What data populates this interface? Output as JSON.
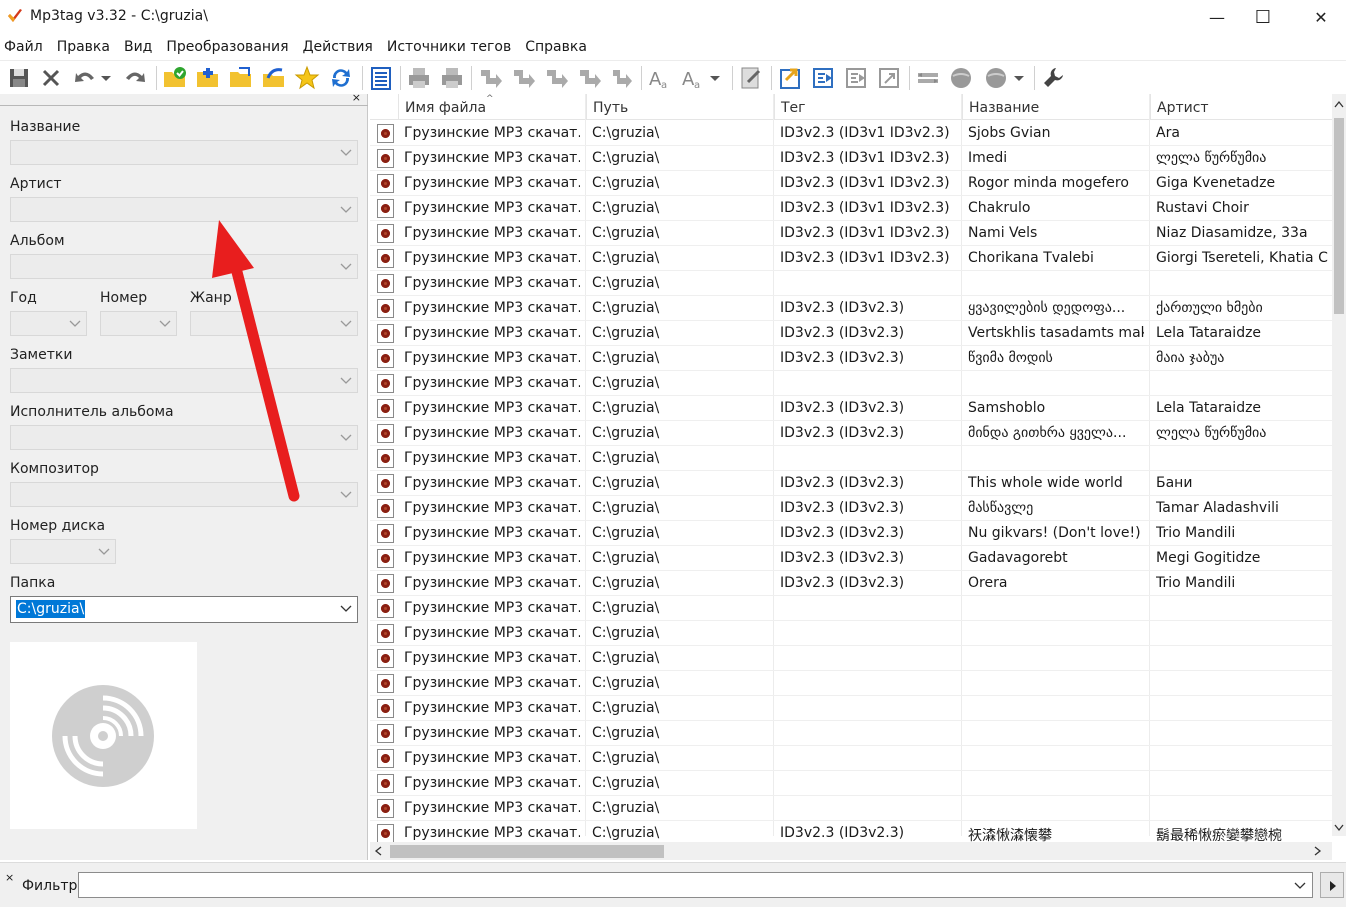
{
  "window": {
    "title": "Mp3tag v3.32  -  C:\\gruzia\\",
    "minimize": "—",
    "maximize": "☐",
    "close": "✕"
  },
  "menu": [
    "Файл",
    "Правка",
    "Вид",
    "Преобразования",
    "Действия",
    "Источники тегов",
    "Справка"
  ],
  "toolbar": {
    "icons": [
      "save-icon",
      "remove-tag-icon",
      "undo-icon",
      "undo-dropdown-icon",
      "redo-icon",
      "change-directory-icon",
      "add-directory-icon",
      "open-folder-icon",
      "favorites-icon",
      "star-icon",
      "refresh-icon",
      "playlist-icon",
      "print-icon",
      "print2-icon",
      "tag-to-filename-icon",
      "filename-to-tag-icon",
      "tag-to-tag-icon",
      "text-file-to-tag-icon",
      "autonumber-icon",
      "case-conversion-icon",
      "replace-icon",
      "extended-tags-icon",
      "export-icon",
      "folder-action-icon",
      "actions-icon",
      "actions-quick-icon",
      "freedb-icon",
      "discogs-icon",
      "web-sources-icon",
      "web-sources-dropdown-icon",
      "options-icon"
    ]
  },
  "left_panel": {
    "close": "×",
    "fields": {
      "title": "Название",
      "artist": "Артист",
      "album": "Альбом",
      "year": "Год",
      "track": "Номер",
      "genre": "Жанр",
      "comment": "Заметки",
      "album_artist": "Исполнитель альбома",
      "composer": "Композитор",
      "disc": "Номер диска",
      "folder": "Папка"
    },
    "folder_value": "C:\\gruzia\\"
  },
  "columns": [
    "Имя файла",
    "Путь",
    "Тег",
    "Название",
    "Артист"
  ],
  "sort_indicator": "^",
  "rows": [
    {
      "file": "Грузинские МР3 скачат...",
      "path": "C:\\gruzia\\",
      "tag": "ID3v2.3 (ID3v1 ID3v2.3)",
      "title": "Sjobs Gvian",
      "artist": "Ara"
    },
    {
      "file": "Грузинские МР3 скачат...",
      "path": "C:\\gruzia\\",
      "tag": "ID3v2.3 (ID3v1 ID3v2.3)",
      "title": "Imedi",
      "artist": "ლელა წურწუმია"
    },
    {
      "file": "Грузинские МР3 скачат...",
      "path": "C:\\gruzia\\",
      "tag": "ID3v2.3 (ID3v1 ID3v2.3)",
      "title": "Rogor minda mogefero",
      "artist": "Giga Kvenetadze"
    },
    {
      "file": "Грузинские МР3 скачат...",
      "path": "C:\\gruzia\\",
      "tag": "ID3v2.3 (ID3v1 ID3v2.3)",
      "title": "Chakrulo",
      "artist": "Rustavi Choir"
    },
    {
      "file": "Грузинские МР3 скачат...",
      "path": "C:\\gruzia\\",
      "tag": "ID3v2.3 (ID3v1 ID3v2.3)",
      "title": "Nami Vels",
      "artist": "Niaz Diasamidze, 33a"
    },
    {
      "file": "Грузинские МР3 скачат...",
      "path": "C:\\gruzia\\",
      "tag": "ID3v2.3 (ID3v1 ID3v2.3)",
      "title": "Chorikana Tvalebi",
      "artist": "Giorgi Tsereteli, Khatia C..."
    },
    {
      "file": "Грузинские МР3 скачат...",
      "path": "C:\\gruzia\\",
      "tag": "",
      "title": "",
      "artist": ""
    },
    {
      "file": "Грузинские МР3 скачат...",
      "path": "C:\\gruzia\\",
      "tag": "ID3v2.3 (ID3v2.3)",
      "title": "ყვავილების დედოფა...",
      "artist": "ქართული ხმები"
    },
    {
      "file": "Грузинские МР3 скачат...",
      "path": "C:\\gruzia\\",
      "tag": "ID3v2.3 (ID3v2.3)",
      "title": "Vertskhlis tasadamts mak...",
      "artist": "Lela Tataraidze"
    },
    {
      "file": "Грузинские МР3 скачат...",
      "path": "C:\\gruzia\\",
      "tag": "ID3v2.3 (ID3v2.3)",
      "title": "წვიმა მოდის",
      "artist": "მაია ჯაბუა"
    },
    {
      "file": "Грузинские МР3 скачат...",
      "path": "C:\\gruzia\\",
      "tag": "",
      "title": "",
      "artist": ""
    },
    {
      "file": "Грузинские МР3 скачат...",
      "path": "C:\\gruzia\\",
      "tag": "ID3v2.3 (ID3v2.3)",
      "title": "Samshoblo",
      "artist": "Lela Tataraidze"
    },
    {
      "file": "Грузинские МР3 скачат...",
      "path": "C:\\gruzia\\",
      "tag": "ID3v2.3 (ID3v2.3)",
      "title": "მინდა გითხრა ყველა...",
      "artist": "ლელა წურწუმია"
    },
    {
      "file": "Грузинские МР3 скачат...",
      "path": "C:\\gruzia\\",
      "tag": "",
      "title": "",
      "artist": ""
    },
    {
      "file": "Грузинские МР3 скачат...",
      "path": "C:\\gruzia\\",
      "tag": "ID3v2.3 (ID3v2.3)",
      "title": "This whole wide world",
      "artist": "Бани"
    },
    {
      "file": "Грузинские МР3 скачат...",
      "path": "C:\\gruzia\\",
      "tag": "ID3v2.3 (ID3v2.3)",
      "title": "მასწავლე",
      "artist": "Tamar Aladashvili"
    },
    {
      "file": "Грузинские МР3 скачат...",
      "path": "C:\\gruzia\\",
      "tag": "ID3v2.3 (ID3v2.3)",
      "title": "Nu gikvars! (Don't love!)",
      "artist": "Trio Mandili"
    },
    {
      "file": "Грузинские МР3 скачат...",
      "path": "C:\\gruzia\\",
      "tag": "ID3v2.3 (ID3v2.3)",
      "title": "Gadavagorebt",
      "artist": "Megi Gogitidze"
    },
    {
      "file": "Грузинские МР3 скачат...",
      "path": "C:\\gruzia\\",
      "tag": "ID3v2.3 (ID3v2.3)",
      "title": "Orera",
      "artist": "Trio Mandili"
    },
    {
      "file": "Грузинские МР3 скачат...",
      "path": "C:\\gruzia\\",
      "tag": "",
      "title": "",
      "artist": ""
    },
    {
      "file": "Грузинские МР3 скачат...",
      "path": "C:\\gruzia\\",
      "tag": "",
      "title": "",
      "artist": ""
    },
    {
      "file": "Грузинские МР3 скачат...",
      "path": "C:\\gruzia\\",
      "tag": "",
      "title": "",
      "artist": ""
    },
    {
      "file": "Грузинские МР3 скачат...",
      "path": "C:\\gruzia\\",
      "tag": "",
      "title": "",
      "artist": ""
    },
    {
      "file": "Грузинские МР3 скачат...",
      "path": "C:\\gruzia\\",
      "tag": "",
      "title": "",
      "artist": ""
    },
    {
      "file": "Грузинские МР3 скачат...",
      "path": "C:\\gruzia\\",
      "tag": "",
      "title": "",
      "artist": ""
    },
    {
      "file": "Грузинские МР3 скачат...",
      "path": "C:\\gruzia\\",
      "tag": "",
      "title": "",
      "artist": ""
    },
    {
      "file": "Грузинские МР3 скачат...",
      "path": "C:\\gruzia\\",
      "tag": "",
      "title": "",
      "artist": ""
    },
    {
      "file": "Грузинские МР3 скачат...",
      "path": "C:\\gruzia\\",
      "tag": "",
      "title": "",
      "artist": ""
    },
    {
      "file": "Грузинские МР3 скачат...",
      "path": "C:\\gruzia\\",
      "tag": "ID3v2.3 (ID3v2.3)",
      "title": "祆潹愀潹懐攀",
      "artist": "鬍最稀愀瘀孌攀戀椀"
    }
  ],
  "filter": {
    "label": "Фильтр",
    "value": ""
  },
  "annotation": {
    "color": "#e81e1e",
    "icon": "red-arrow-annotation"
  },
  "colors": {
    "selection": "#0078d7",
    "scroll_thumb": "#c1c1c1"
  }
}
